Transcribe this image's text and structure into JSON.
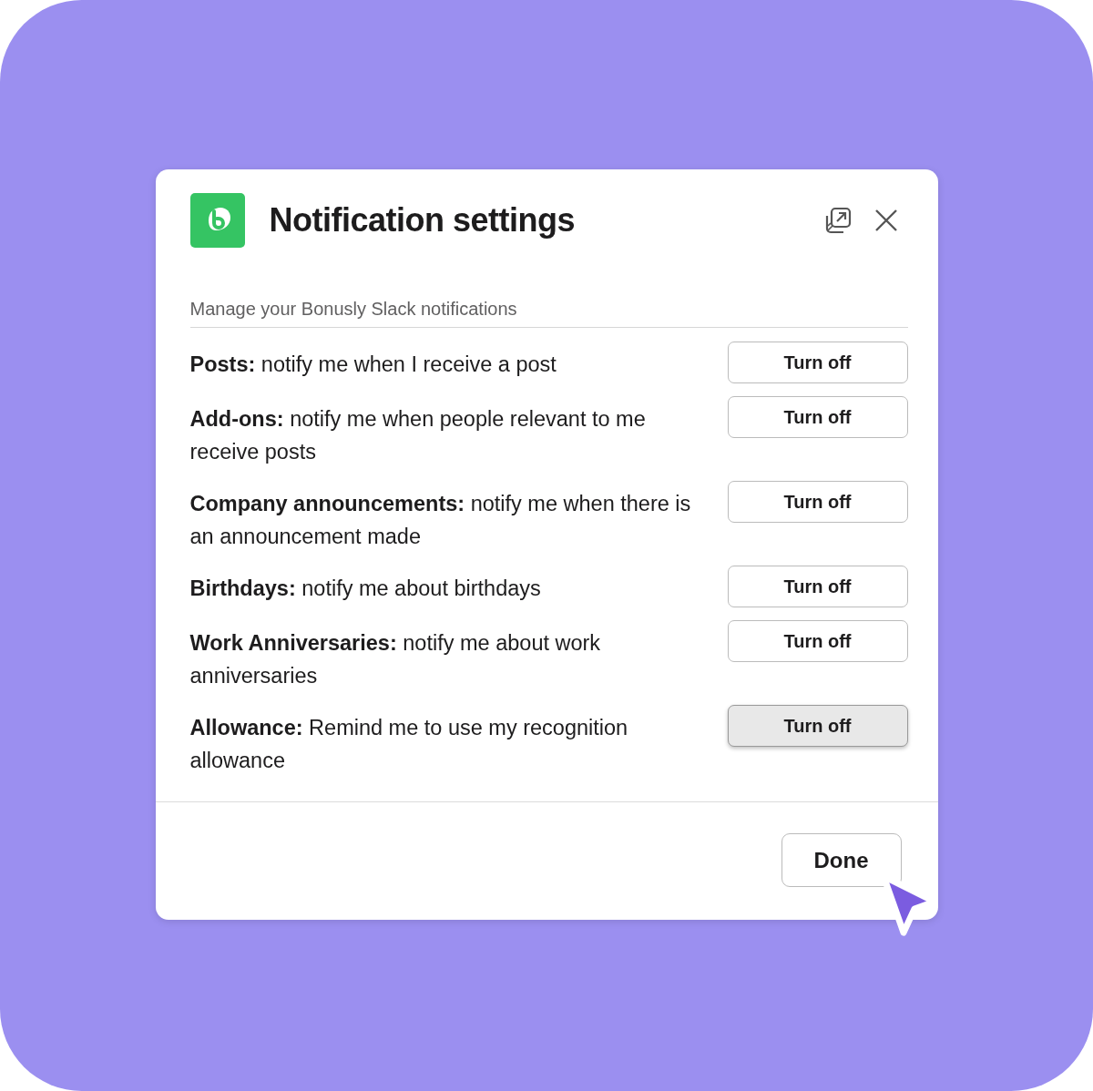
{
  "dialog": {
    "title": "Notification settings",
    "subtitle": "Manage your Bonusly Slack notifications"
  },
  "settings": [
    {
      "text": "**Posts:** notify me when I receive a post",
      "button": "Turn off",
      "hovered": false
    },
    {
      "text": "**Add-ons:** notify me when people relevant to me receive posts",
      "button": "Turn off",
      "hovered": false
    },
    {
      "text": "**Company announcements:** notify me when there is an announcement made",
      "button": "Turn off",
      "hovered": false
    },
    {
      "text": "**Birthdays:** notify me about birthdays",
      "button": "Turn off",
      "hovered": false
    },
    {
      "text": "**Work Anniversaries:** notify me about work anniversaries",
      "button": "Turn off",
      "hovered": false
    },
    {
      "text": "**Allowance:** Remind me to use my recognition allowance",
      "button": "Turn off",
      "hovered": true
    }
  ],
  "footer": {
    "button": "Done"
  }
}
